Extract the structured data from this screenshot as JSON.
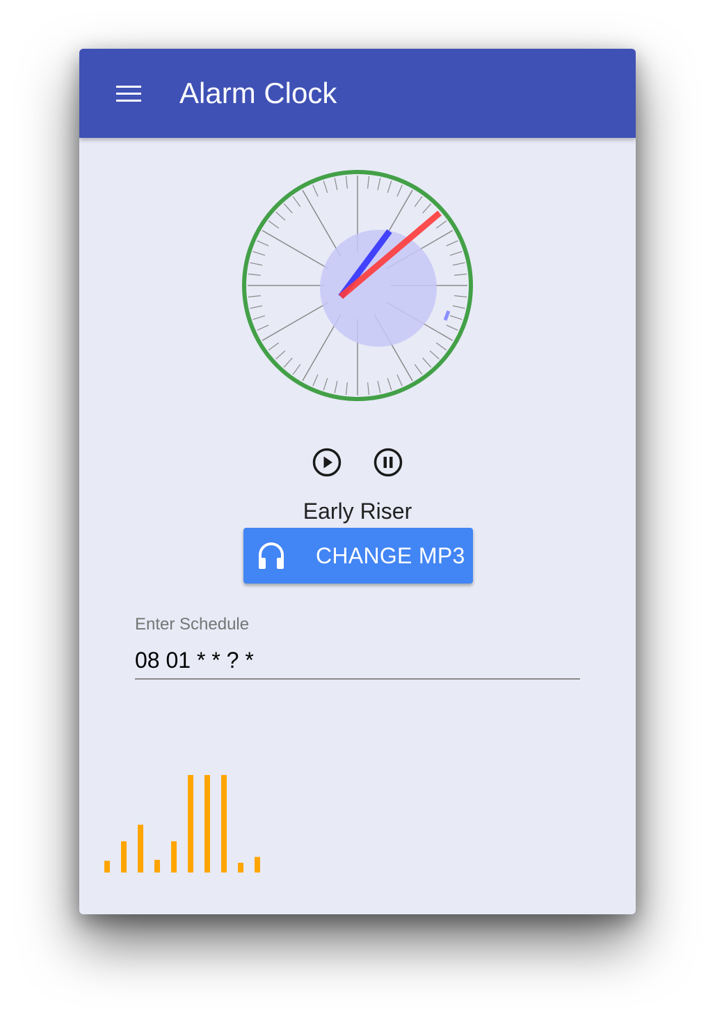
{
  "app": {
    "title": "Alarm Clock"
  },
  "clock": {
    "hour_hand_color": "#3b3bff",
    "minute_hand_color": "#ff3b3b",
    "rim_color": "#43a047",
    "center_disc_color": "#c5c8f7"
  },
  "player": {
    "play_icon": "play-circle-icon",
    "pause_icon": "pause-circle-icon",
    "track_name": "Early Riser",
    "change_button_label": "CHANGE MP3",
    "change_button_icon": "headphones-icon"
  },
  "schedule": {
    "label": "Enter Schedule",
    "value": "08 01 * * ? *"
  },
  "visualizer": {
    "color": "#ffa500",
    "levels": [
      0.12,
      0.32,
      0.49,
      0.13,
      0.32,
      1.0,
      1.0,
      1.0,
      0.1,
      0.16
    ]
  },
  "colors": {
    "app_bar": "#3f51b5",
    "background": "#e8eaf6",
    "button": "#4285f4"
  }
}
